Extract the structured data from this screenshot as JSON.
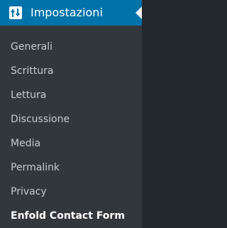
{
  "menu": {
    "title": "Impostazioni",
    "icon": "settings-sliders-icon",
    "items": [
      {
        "label": "Generali",
        "current": false
      },
      {
        "label": "Scrittura",
        "current": false
      },
      {
        "label": "Lettura",
        "current": false
      },
      {
        "label": "Discussione",
        "current": false
      },
      {
        "label": "Media",
        "current": false
      },
      {
        "label": "Permalink",
        "current": false
      },
      {
        "label": "Privacy",
        "current": false
      },
      {
        "label": "Enfold Contact Form",
        "current": true
      }
    ]
  },
  "colors": {
    "header_bg": "#0073aa",
    "submenu_bg": "#32373c",
    "item_text": "#c8cacc",
    "current_text": "#ffffff"
  }
}
